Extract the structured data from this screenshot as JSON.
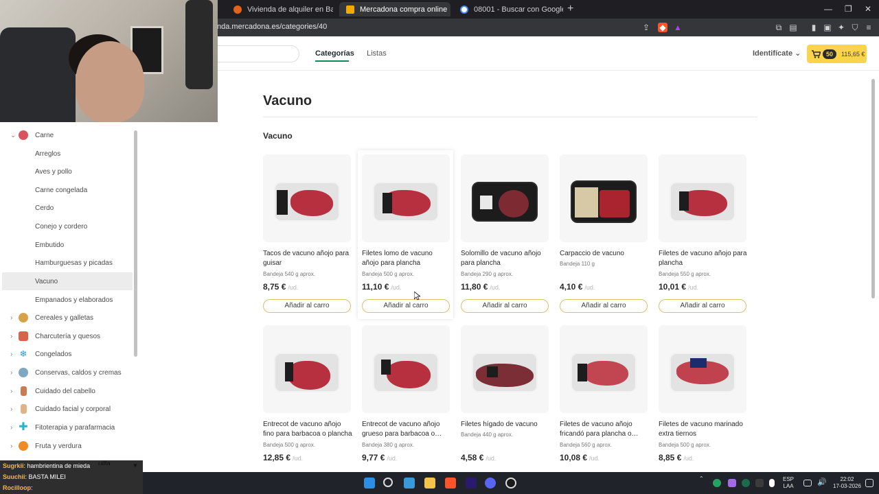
{
  "browser": {
    "tabs": [
      {
        "title": "Vivienda de alquiler en Barcelonès ·",
        "active": false
      },
      {
        "title": "Mercadona compra online",
        "active": true
      },
      {
        "title": "08001 - Buscar con Google",
        "active": false
      }
    ],
    "new_tab": "+",
    "url": "nda.mercadona.es/categories/40"
  },
  "header": {
    "nav": [
      "Categorías",
      "Listas"
    ],
    "identify": "Identifícate",
    "cart_count": "50",
    "cart_total": "115,65 €"
  },
  "sidebar": {
    "parent": "Carne",
    "subcategories": [
      "Arreglos",
      "Aves y pollo",
      "Carne congelada",
      "Cerdo",
      "Conejo y cordero",
      "Embutido",
      "Hamburguesas y picadas",
      "Vacuno",
      "Empanados y elaborados"
    ],
    "active": "Vacuno",
    "categories": [
      "Cereales y galletas",
      "Charcutería y quesos",
      "Congelados",
      "Conservas, caldos y cremas",
      "Cuidado del cabello",
      "Cuidado facial y corporal",
      "Fitoterapia y parafarmacia",
      "Fruta y verdura"
    ],
    "partial_last": "uilla"
  },
  "page": {
    "title": "Vacuno",
    "section": "Vacuno",
    "add_label": "Añadir al carro",
    "unit": "/ud."
  },
  "products": [
    {
      "name": "Tacos de vacuno añojo para guisar",
      "format": "Bandeja 540 g aprox.",
      "price": "8,75 €"
    },
    {
      "name": "Filetes lomo de vacuno añojo para plancha",
      "format": "Bandeja 500 g aprox.",
      "price": "11,10 €"
    },
    {
      "name": "Solomillo de vacuno añojo para plancha",
      "format": "Bandeja 290 g aprox.",
      "price": "11,80 €"
    },
    {
      "name": "Carpaccio de vacuno",
      "format": "Bandeja 110 g",
      "price": "4,10 €"
    },
    {
      "name": "Filetes de vacuno añojo para plancha",
      "format": "Bandeja 550 g aprox.",
      "price": "10,01 €"
    },
    {
      "name": "Entrecot de vacuno añojo fino para barbacoa o plancha",
      "format": "Bandeja 500 g aprox.",
      "price": "12,85 €"
    },
    {
      "name": "Entrecot de vacuno añojo grueso para barbacoa o…",
      "format": "Bandeja 380 g aprox.",
      "price": "9,77 €"
    },
    {
      "name": "Filetes hígado de vacuno",
      "format": "Bandeja 440 g aprox.",
      "price": "4,58 €"
    },
    {
      "name": "Filetes de vacuno añojo fricandó para plancha o…",
      "format": "Bandeja 560 g aprox.",
      "price": "10,08 €"
    },
    {
      "name": "Filetes de vacuno marinado extra tiernos",
      "format": "Bandeja 500 g aprox.",
      "price": "8,85 €"
    }
  ],
  "chat": [
    {
      "user": "Sugrkii",
      "text": ": hambrientina de mieda"
    },
    {
      "user": "Suuchii",
      "text": ": BASTA MILEI"
    },
    {
      "user": "Rocilloop",
      "text": ":"
    }
  ],
  "taskbar": {
    "lang": "ESP",
    "layout": "LAA",
    "time": "22:02",
    "date": "17-03-2026"
  },
  "colors": {
    "accent_green": "#0c8a5b",
    "cart_yellow": "#fcd34d",
    "button_border": "#d9c26a"
  },
  "icons": {
    "carne": "meat-icon",
    "cart": "cart-icon"
  }
}
